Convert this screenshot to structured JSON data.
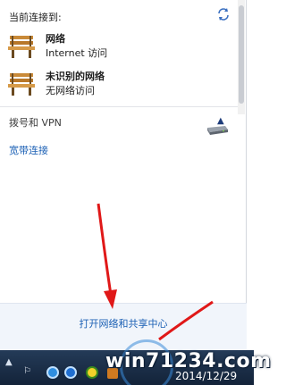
{
  "flyout": {
    "header": "当前连接到:",
    "networks": [
      {
        "name": "网络",
        "status": "Internet 访问"
      },
      {
        "name": "未识别的网络",
        "status": "无网络访问"
      }
    ],
    "section_label": "拨号和 VPN",
    "broadband_label": "宽带连接",
    "open_center_label": "打开网络和共享中心"
  },
  "taskbar": {
    "date": "2014/12/29",
    "watermark": "win71234.com"
  },
  "colors": {
    "link": "#1a5fb4",
    "arrow": "#e01818",
    "taskbar": "#1b2f48"
  }
}
